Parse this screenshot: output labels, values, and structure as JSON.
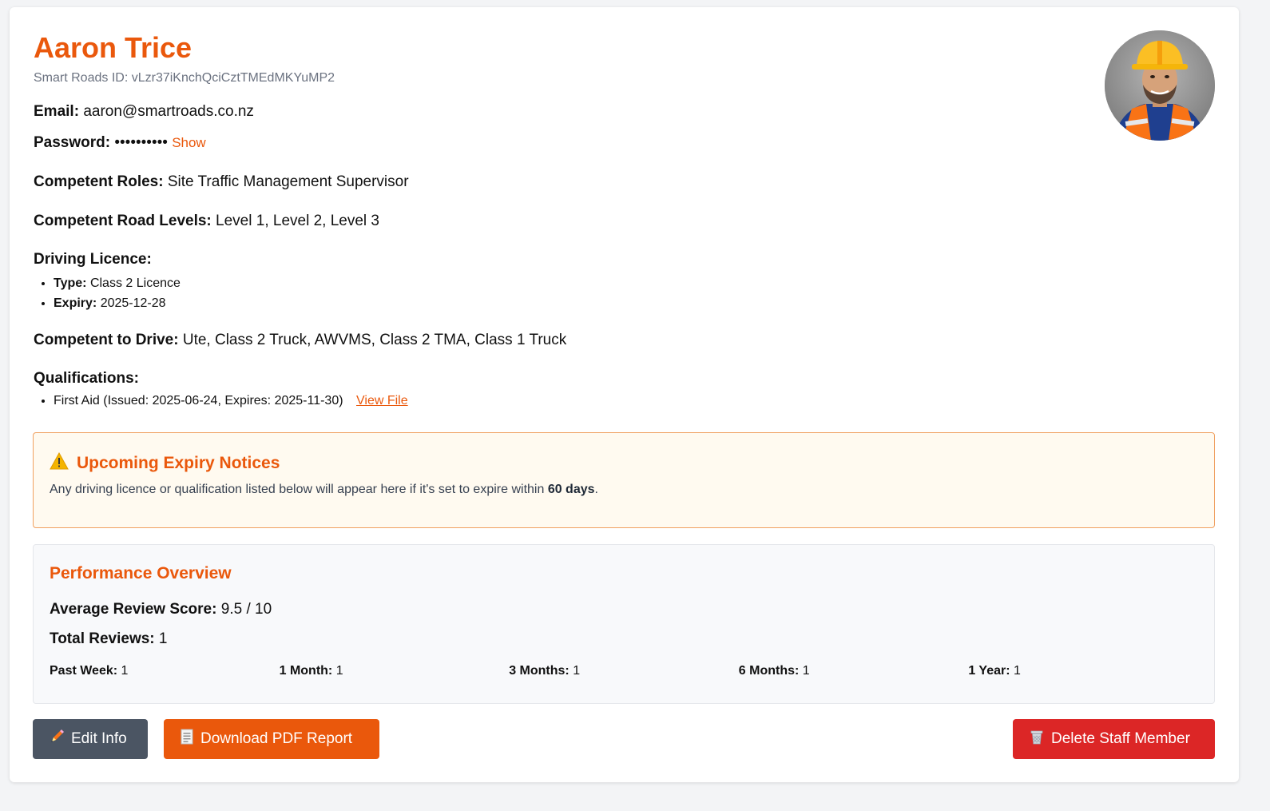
{
  "profile": {
    "name": "Aaron Trice",
    "id_label": "Smart Roads ID:",
    "id_value": "vLzr37iKnchQciCztTMEdMKYuMP2",
    "email_label": "Email:",
    "email": "aaron@smartroads.co.nz",
    "password_label": "Password:",
    "password_mask": "••••••••••",
    "show_label": "Show",
    "roles_label": "Competent Roles:",
    "roles": "Site Traffic Management Supervisor",
    "levels_label": "Competent Road Levels:",
    "levels": "Level 1, Level 2, Level 3",
    "licence_label": "Driving Licence:",
    "licence_type_label": "Type:",
    "licence_type": "Class 2 Licence",
    "licence_expiry_label": "Expiry:",
    "licence_expiry": "2025-12-28",
    "drive_label": "Competent to Drive:",
    "drive": "Ute, Class 2 Truck, AWVMS, Class 2 TMA, Class 1 Truck",
    "qualifications_label": "Qualifications:",
    "qualifications": [
      {
        "text": "First Aid (Issued: 2025-06-24, Expires: 2025-11-30)",
        "link": "View File"
      }
    ]
  },
  "notice": {
    "icon": "warning-icon",
    "title": "Upcoming Expiry Notices",
    "text_before": "Any driving licence or qualification listed below will appear here if it's set to expire within ",
    "text_bold": "60 days",
    "text_after": "."
  },
  "performance": {
    "title": "Performance Overview",
    "avg_label": "Average Review Score:",
    "avg_value": "9.5 / 10",
    "total_label": "Total Reviews:",
    "total_value": "1",
    "periods": [
      {
        "label": "Past Week:",
        "value": "1"
      },
      {
        "label": "1 Month:",
        "value": "1"
      },
      {
        "label": "3 Months:",
        "value": "1"
      },
      {
        "label": "6 Months:",
        "value": "1"
      },
      {
        "label": "1 Year:",
        "value": "1"
      }
    ]
  },
  "actions": {
    "edit": "Edit Info",
    "download": "Download PDF Report",
    "delete": "Delete Staff Member"
  },
  "colors": {
    "accent": "#ea580c",
    "danger": "#dc2626",
    "secondary": "#4b5563"
  }
}
